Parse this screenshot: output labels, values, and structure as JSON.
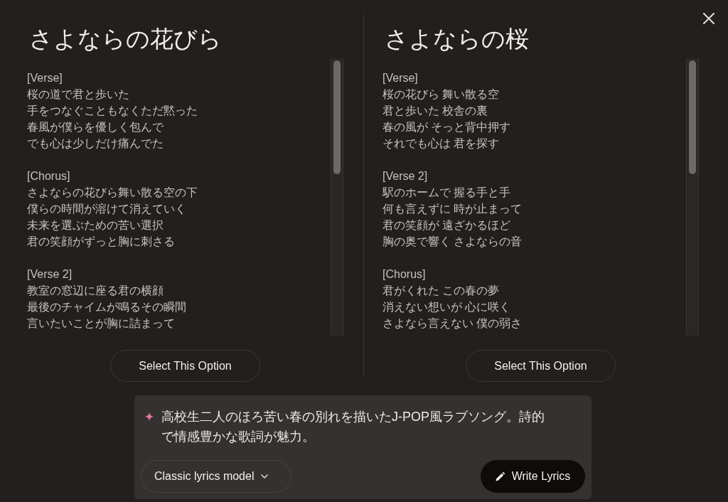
{
  "options": [
    {
      "title": "さよならの花びら",
      "sections": [
        {
          "heading": "[Verse]",
          "lines": [
            "桜の道で君と歩いた",
            "手をつなぐこともなくただ黙った",
            "春風が僕らを優しく包んで",
            "でも心は少しだけ痛んでた"
          ]
        },
        {
          "heading": "[Chorus]",
          "lines": [
            "さよならの花びら舞い散る空の下",
            "僕らの時間が溶けて消えていく",
            "未来を選ぶための苦い選択",
            "君の笑顔がずっと胸に刺さる"
          ]
        },
        {
          "heading": "[Verse 2]",
          "lines": [
            "教室の窓辺に座る君の横顔",
            "最後のチャイムが鳴るその瞬間",
            "言いたいことが胸に詰まって"
          ]
        }
      ],
      "select_button": "Select This Option"
    },
    {
      "title": "さよならの桜",
      "sections": [
        {
          "heading": "[Verse]",
          "lines": [
            "桜の花びら 舞い散る空",
            "君と歩いた 校舎の裏",
            "春の風が そっと背中押す",
            "それでも心は 君を探す"
          ]
        },
        {
          "heading": "[Verse 2]",
          "lines": [
            "駅のホームで 握る手と手",
            "何も言えずに 時が止まって",
            "君の笑顔が 遠ざかるほど",
            "胸の奥で響く さよならの音"
          ]
        },
        {
          "heading": "[Chorus]",
          "lines": [
            "君がくれた この春の夢",
            "消えない想いが 心に咲く",
            "さよなら言えない 僕の弱さ"
          ]
        }
      ],
      "select_button": "Select This Option"
    }
  ],
  "prompt": {
    "text": "高校生二人のほろ苦い春の別れを描いたJ-POP風ラブソング。詩的で情感豊かな歌詞が魅力。",
    "model_dropdown": "Classic lyrics model",
    "write_button": "Write Lyrics"
  }
}
